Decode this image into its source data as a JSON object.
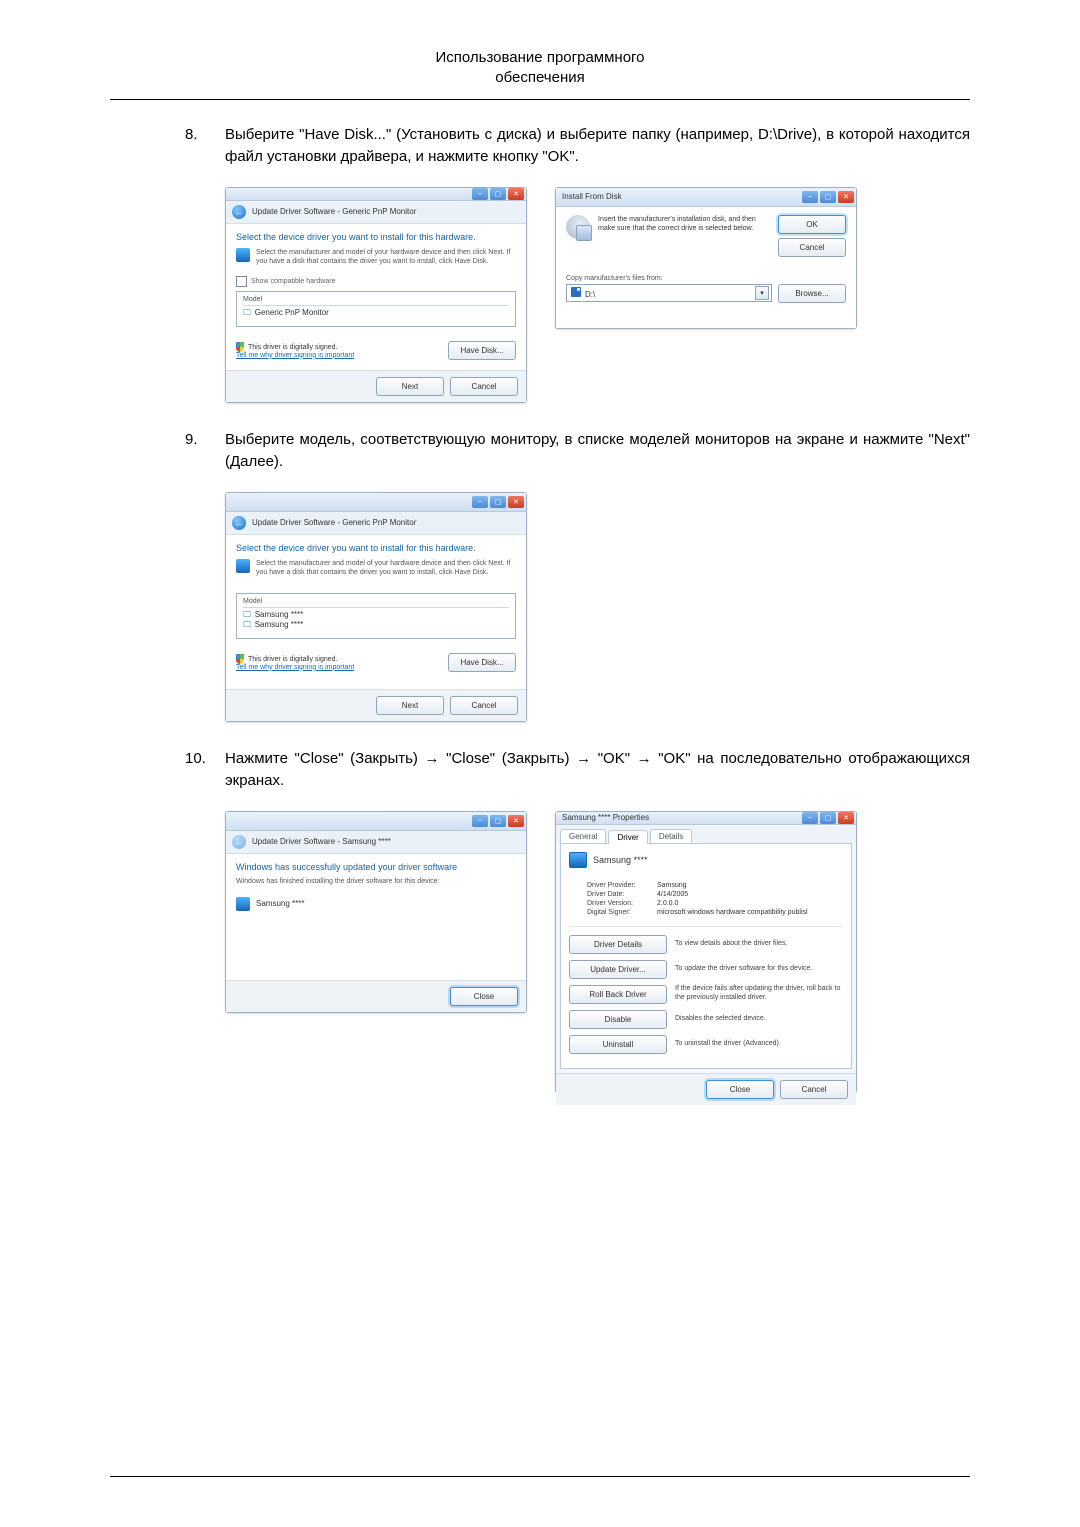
{
  "header": {
    "line1": "Использование программного",
    "line2": "обеспечения"
  },
  "step8": {
    "num": "8.",
    "text": "Выберите \"Have Disk...\" (Установить с диска) и выберите папку (например, D:\\Drive), в которой находится файл установки драйвера, и нажмите кнопку \"OK\"."
  },
  "step9": {
    "num": "9.",
    "text": "Выберите модель, соответствующую монитору, в списке моделей мониторов на экране и нажмите \"Next\" (Далее)."
  },
  "step10": {
    "num": "10.",
    "text": "Нажмите \"Close\" (Закрыть) → \"Close\" (Закрыть) → \"OK\" → \"OK\" на последовательно отображающихся экранах."
  },
  "dlg_update1": {
    "crumb": "Update Driver Software - Generic PnP Monitor",
    "heading": "Select the device driver you want to install for this hardware.",
    "sub": "Select the manufacturer and model of your hardware device and then click Next. If you have a disk that contains the driver you want to install, click Have Disk.",
    "compat": "Show compatible hardware",
    "model_hdr": "Model",
    "model_item": "Generic PnP Monitor",
    "signed": "This driver is digitally signed.",
    "signed_link": "Tell me why driver signing is important",
    "havedisk": "Have Disk...",
    "next": "Next",
    "cancel": "Cancel"
  },
  "dlg_ifd": {
    "title": "Install From Disk",
    "msg": "Insert the manufacturer's installation disk, and then make sure that the correct drive is selected below.",
    "ok": "OK",
    "cancel": "Cancel",
    "copy_label": "Copy manufacturer's files from:",
    "path": "D:\\",
    "browse": "Browse..."
  },
  "dlg_update2": {
    "crumb": "Update Driver Software - Generic PnP Monitor",
    "heading": "Select the device driver you want to install for this hardware.",
    "sub": "Select the manufacturer and model of your hardware device and then click Next. If you have a disk that contains the driver you want to install, click Have Disk.",
    "model_hdr": "Model",
    "model_item1": "Samsung ****",
    "model_item2": "Samsung ****",
    "signed": "This driver is digitally signed.",
    "signed_link": "Tell me why driver signing is important",
    "havedisk": "Have Disk...",
    "next": "Next",
    "cancel": "Cancel"
  },
  "dlg_done": {
    "crumb": "Update Driver Software - Samsung ****",
    "heading": "Windows has successfully updated your driver software",
    "sub": "Windows has finished installing the driver software for this device:",
    "item": "Samsung ****",
    "close": "Close"
  },
  "dlg_props": {
    "title": "Samsung **** Properties",
    "tabs": {
      "general": "General",
      "driver": "Driver",
      "details": "Details"
    },
    "device": "Samsung ****",
    "rows": {
      "provider_k": "Driver Provider:",
      "provider_v": "Samsung",
      "date_k": "Driver Date:",
      "date_v": "4/14/2005",
      "version_k": "Driver Version:",
      "version_v": "2.0.0.0",
      "signer_k": "Digital Signer:",
      "signer_v": "microsoft windows hardware compatibility publisl"
    },
    "btns": {
      "details": "Driver Details",
      "details_d": "To view details about the driver files.",
      "update": "Update Driver...",
      "update_d": "To update the driver software for this device.",
      "rollback": "Roll Back Driver",
      "rollback_d": "If the device fails after updating the driver, roll back to the previously installed driver.",
      "disable": "Disable",
      "disable_d": "Disables the selected device.",
      "uninstall": "Uninstall",
      "uninstall_d": "To uninstall the driver (Advanced)."
    },
    "close": "Close",
    "cancel": "Cancel"
  }
}
